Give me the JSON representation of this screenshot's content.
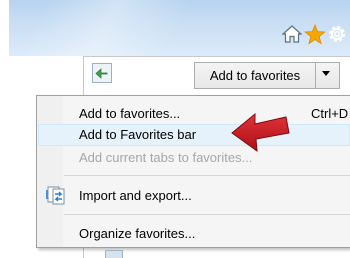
{
  "toolbar": {
    "home_icon": "home-icon",
    "favorites_icon": "star-icon",
    "tools_icon": "gear-icon"
  },
  "favorites_pane": {
    "back_icon": "green-back-arrow-icon",
    "add_button_label": "Add to favorites"
  },
  "menu": {
    "items": [
      {
        "label": "Add to favorites...",
        "shortcut": "Ctrl+D",
        "state": "normal"
      },
      {
        "label": "Add to Favorites bar",
        "shortcut": "",
        "state": "highlighted"
      },
      {
        "label": "Add current tabs to favorites...",
        "shortcut": "",
        "state": "disabled"
      },
      {
        "label": "Import and export...",
        "shortcut": "",
        "state": "normal",
        "icon": "import-export-icon"
      },
      {
        "label": "Organize favorites...",
        "shortcut": "",
        "state": "normal"
      }
    ]
  },
  "annotation": {
    "arrow_color": "#c8141a",
    "arrow_icon": "red-pointer-arrow"
  },
  "colors": {
    "star": "#f6a800",
    "menu_highlight": "#e5f1fb"
  }
}
